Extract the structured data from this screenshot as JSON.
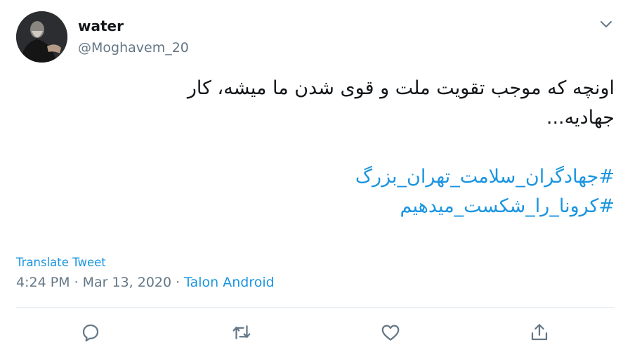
{
  "author": {
    "display_name": "water",
    "handle": "@Moghavem_20",
    "avatar_icon": "profile-photo"
  },
  "tweet": {
    "text_line1": "اونچه که موجب تقویت ملت و قوی شدن ما میشه، کار",
    "text_line2": "جهادیه...",
    "hashtags": [
      "#جهادگران_سلامت_تهران_بزرگ",
      "#کرونا_را_شکست_میدهیم"
    ]
  },
  "translate_label": "Translate Tweet",
  "meta": {
    "time": "4:24 PM",
    "separator1": "·",
    "date": "Mar 13, 2020",
    "separator2": "·",
    "source": "Talon Android"
  },
  "actions": {
    "icons": [
      "reply-icon",
      "retweet-icon",
      "like-icon",
      "share-icon"
    ]
  },
  "colors": {
    "link": "#1b95e0",
    "secondary_text": "#657786",
    "primary_text": "#14171a",
    "divider": "#e6ecf0"
  }
}
